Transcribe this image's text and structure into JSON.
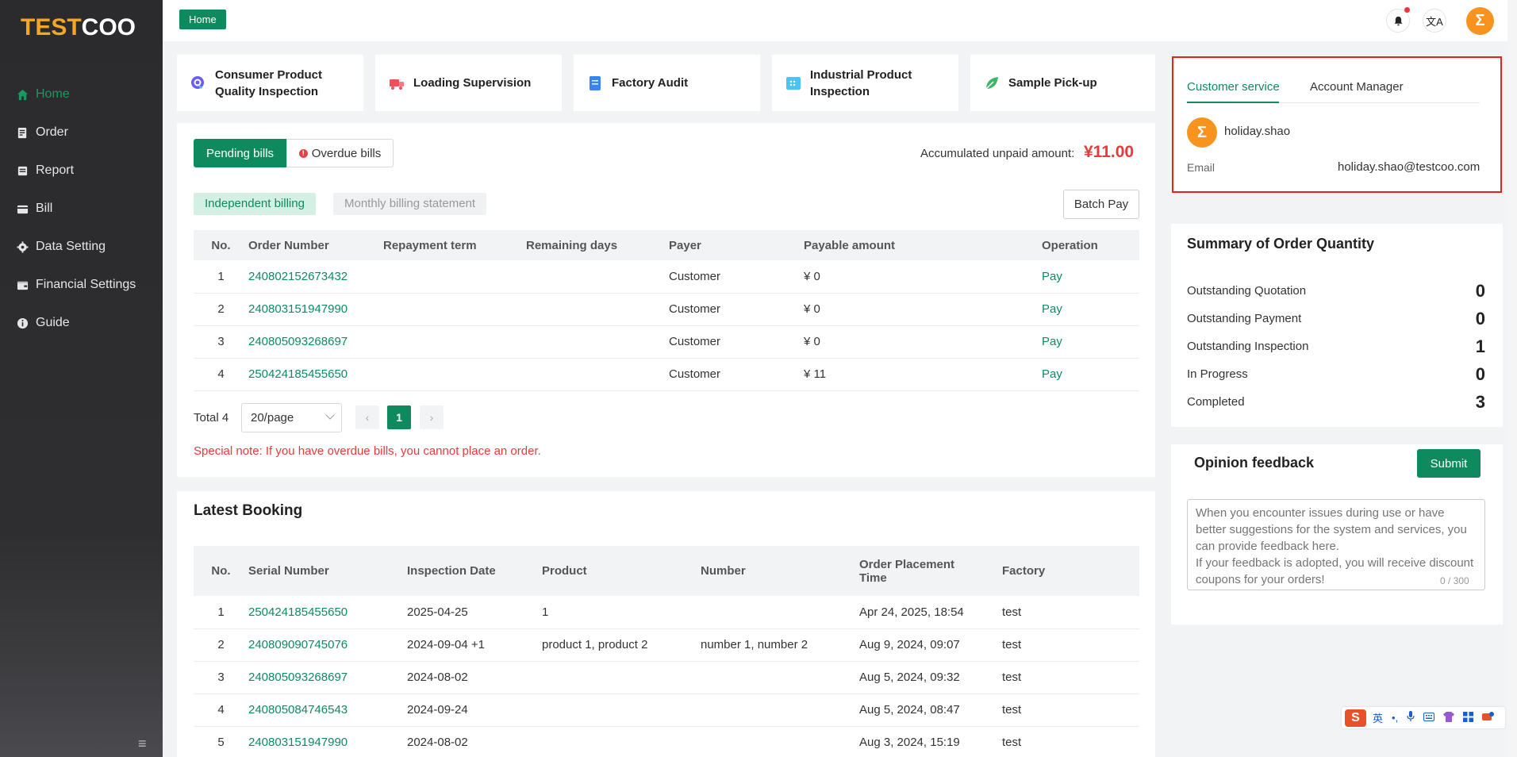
{
  "brand": {
    "part1": "TEST",
    "part2": "COO"
  },
  "sidebar": {
    "items": [
      {
        "label": "Home",
        "icon": "home-icon"
      },
      {
        "label": "Order",
        "icon": "order-icon"
      },
      {
        "label": "Report",
        "icon": "report-icon"
      },
      {
        "label": "Bill",
        "icon": "bill-icon"
      },
      {
        "label": "Data Setting",
        "icon": "gear-icon"
      },
      {
        "label": "Financial Settings",
        "icon": "wallet-icon"
      },
      {
        "label": "Guide",
        "icon": "info-icon"
      }
    ],
    "collapse_glyph": "≡"
  },
  "topbar": {
    "tag": "Home",
    "translate_glyph": "文A",
    "avatar_glyph": "Σ"
  },
  "services": [
    {
      "label_line1": "Consumer Product",
      "label_line2": "Quality Inspection",
      "icon": "search-icon",
      "color": "#6b5cf6"
    },
    {
      "label_line1": "Loading Supervision",
      "label_line2": "",
      "icon": "truck-icon",
      "color": "#f0505a"
    },
    {
      "label_line1": "Factory Audit",
      "label_line2": "",
      "icon": "document-icon",
      "color": "#3b82f6"
    },
    {
      "label_line1": "Industrial Product",
      "label_line2": "Inspection",
      "icon": "grid-icon",
      "color": "#4cc3f0"
    },
    {
      "label_line1": "Sample Pick-up",
      "label_line2": "",
      "icon": "leaf-icon",
      "color": "#3fb56a"
    }
  ],
  "bills": {
    "tab_pending": "Pending bills",
    "tab_overdue": "Overdue bills",
    "accumulated_label": "Accumulated unpaid amount:",
    "accumulated_value": "¥11.00",
    "filter_independent": "Independent billing",
    "filter_monthly": "Monthly billing statement",
    "batch_pay": "Batch Pay",
    "columns": [
      "No.",
      "Order Number",
      "Repayment term",
      "Remaining days",
      "Payer",
      "Payable amount",
      "Operation"
    ],
    "rows": [
      {
        "no": "1",
        "order": "240802152673432",
        "term": "",
        "days": "",
        "payer": "Customer",
        "amount": "¥ 0",
        "op": "Pay"
      },
      {
        "no": "2",
        "order": "240803151947990",
        "term": "",
        "days": "",
        "payer": "Customer",
        "amount": "¥ 0",
        "op": "Pay"
      },
      {
        "no": "3",
        "order": "240805093268697",
        "term": "",
        "days": "",
        "payer": "Customer",
        "amount": "¥ 0",
        "op": "Pay"
      },
      {
        "no": "4",
        "order": "250424185455650",
        "term": "",
        "days": "",
        "payer": "Customer",
        "amount": "¥ 11",
        "op": "Pay"
      }
    ],
    "total": "Total 4",
    "page_size": "20/page",
    "current_page": "1",
    "prev": "‹",
    "next": "›",
    "note": "Special note: If you have overdue bills, you cannot place an order."
  },
  "booking": {
    "title": "Latest Booking",
    "columns": [
      "No.",
      "Serial Number",
      "Inspection Date",
      "Product",
      "Number",
      "Order Placement Time",
      "Factory"
    ],
    "col_order_line1": "Order Placement",
    "col_order_line2": "Time",
    "rows": [
      {
        "no": "1",
        "serial": "250424185455650",
        "date": "2025-04-25",
        "product": "1",
        "number": "",
        "time": "Apr 24, 2025, 18:54",
        "factory": "test"
      },
      {
        "no": "2",
        "serial": "240809090745076",
        "date": "2024-09-04 +1",
        "product": "product 1, product 2",
        "number": "number 1, number 2",
        "time": "Aug 9, 2024, 09:07",
        "factory": "test"
      },
      {
        "no": "3",
        "serial": "240805093268697",
        "date": "2024-08-02",
        "product": "",
        "number": "",
        "time": "Aug 5, 2024, 09:32",
        "factory": "test"
      },
      {
        "no": "4",
        "serial": "240805084746543",
        "date": "2024-09-24",
        "product": "",
        "number": "",
        "time": "Aug 5, 2024, 08:47",
        "factory": "test"
      },
      {
        "no": "5",
        "serial": "240803151947990",
        "date": "2024-08-02",
        "product": "",
        "number": "",
        "time": "Aug 3, 2024, 15:19",
        "factory": "test"
      }
    ]
  },
  "service_contact": {
    "tab_customer": "Customer service",
    "tab_manager": "Account Manager",
    "name": "holiday.shao",
    "email_label": "Email",
    "email": "holiday.shao@testcoo.com",
    "avatar_glyph": "Σ"
  },
  "summary": {
    "title": "Summary of Order Quantity",
    "rows": [
      {
        "label": "Outstanding Quotation",
        "value": "0"
      },
      {
        "label": "Outstanding Payment",
        "value": "0"
      },
      {
        "label": "Outstanding Inspection",
        "value": "1"
      },
      {
        "label": "In Progress",
        "value": "0"
      },
      {
        "label": "Completed",
        "value": "3"
      }
    ]
  },
  "feedback": {
    "title": "Opinion feedback",
    "submit": "Submit",
    "placeholder": "When you encounter issues during use or have better suggestions for the system and services, you can provide feedback here.\nIf your feedback is adopted, you will receive discount coupons for your orders!",
    "count": "0 / 300"
  },
  "ime": {
    "logo": "S",
    "lang": "英",
    "punct": "•,"
  },
  "colors": {
    "accent": "#0f8a5f",
    "danger": "#e8393b",
    "sidebar": "#2b2b2d",
    "highlight_border": "#e8221b"
  }
}
